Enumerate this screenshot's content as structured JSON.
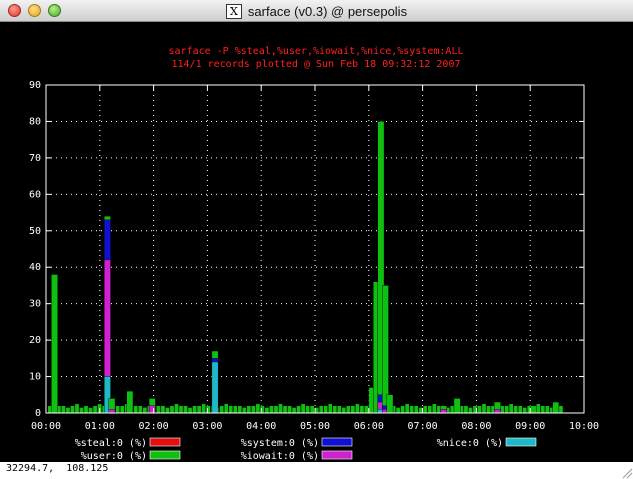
{
  "window": {
    "title": "sarface (v0.3) @ persepolis",
    "x_logo": "X"
  },
  "status_bar": {
    "coords": "32294.7,  108.125"
  },
  "colors": {
    "title": "#ff2020",
    "grid": "#ffffff",
    "steal": "#e01010",
    "user": "#10c010",
    "system": "#1010d0",
    "iowait": "#d020d0",
    "nice": "#20b8c8"
  },
  "chart_data": {
    "type": "bar",
    "title": "sarface -P %steal,%user,%iowait,%nice,%system:ALL",
    "subtitle": "114/1 records plotted @ Sun Feb 18 09:32:12 2007",
    "xlabel": "",
    "ylabel": "",
    "ylim": [
      0,
      90
    ],
    "yticks": [
      "0",
      "10",
      "20",
      "30",
      "40",
      "50",
      "60",
      "70",
      "80",
      "90"
    ],
    "xticks": [
      "00:00",
      "01:00",
      "02:00",
      "03:00",
      "04:00",
      "05:00",
      "06:00",
      "07:00",
      "08:00",
      "09:00",
      "10:00"
    ],
    "xlim_minutes": [
      0,
      600
    ],
    "grid": true,
    "series": [
      {
        "name": "%steal:0 (%)",
        "key": "steal",
        "color": "#e01010"
      },
      {
        "name": "%user:0 (%)",
        "key": "user",
        "color": "#10c010"
      },
      {
        "name": "%system:0 (%)",
        "key": "system",
        "color": "#1010d0"
      },
      {
        "name": "%iowait:0 (%)",
        "key": "iowait",
        "color": "#d020d0"
      },
      {
        "name": "%nice:0 (%)",
        "key": "nice",
        "color": "#20b8c8"
      }
    ],
    "baseline_user": [
      2,
      3,
      2,
      2,
      1.5,
      2,
      2.5,
      1.5,
      2,
      1.5,
      2,
      2.5,
      2,
      1.5,
      2,
      2,
      2,
      2.5,
      1.5,
      2,
      2,
      1.5,
      2,
      2.5,
      2,
      2,
      1.5,
      2,
      2.5,
      2,
      2,
      1.5,
      2,
      2,
      2.5,
      2,
      2,
      1.5,
      2,
      2.5,
      2,
      2,
      2,
      1.5,
      2,
      2,
      2.5,
      2,
      1.5,
      2,
      2,
      2.5,
      2,
      2,
      1.5,
      2,
      2.5,
      2,
      2,
      1.5,
      2,
      2,
      2.5,
      2,
      2,
      1.5,
      2,
      2,
      2.5,
      2,
      2,
      1.5,
      2,
      2,
      2.5,
      2,
      2,
      1.5,
      2,
      2.5,
      2,
      2,
      1.5,
      2,
      2,
      2.5,
      2,
      2,
      1.5,
      2,
      2.5,
      2,
      2,
      1.5,
      2,
      2,
      2.5,
      2,
      2,
      1.5,
      2,
      2,
      2.5,
      2,
      2,
      1.5,
      2,
      2,
      2.5,
      2,
      2,
      1.5,
      2,
      2
    ],
    "spikes": [
      {
        "time": "00:06",
        "user": 38,
        "system": 0,
        "iowait": 0,
        "nice": 0
      },
      {
        "time": "01:05",
        "user": 54,
        "system": 53,
        "iowait": 42,
        "nice": 10
      },
      {
        "time": "01:10",
        "user": 4,
        "system": 0,
        "iowait": 1,
        "nice": 0
      },
      {
        "time": "01:30",
        "user": 6,
        "system": 0,
        "iowait": 0,
        "nice": 0
      },
      {
        "time": "01:55",
        "user": 4,
        "system": 0,
        "iowait": 2,
        "nice": 0
      },
      {
        "time": "03:05",
        "user": 17,
        "system": 15,
        "iowait": 0,
        "nice": 14
      },
      {
        "time": "06:00",
        "user": 7,
        "system": 0,
        "iowait": 0,
        "nice": 0
      },
      {
        "time": "06:05",
        "user": 36,
        "system": 0,
        "iowait": 0,
        "nice": 0
      },
      {
        "time": "06:10",
        "user": 80,
        "system": 5,
        "iowait": 3,
        "nice": 1
      },
      {
        "time": "06:15",
        "user": 35,
        "system": 2,
        "iowait": 1,
        "nice": 0
      },
      {
        "time": "06:20",
        "user": 5,
        "system": 0,
        "iowait": 0,
        "nice": 0
      },
      {
        "time": "07:20",
        "user": 2,
        "system": 0,
        "iowait": 1,
        "nice": 0
      },
      {
        "time": "07:35",
        "user": 4,
        "system": 0,
        "iowait": 0,
        "nice": 0
      },
      {
        "time": "08:20",
        "user": 3,
        "system": 0,
        "iowait": 1,
        "nice": 0
      },
      {
        "time": "09:00",
        "user": 2,
        "system": 0,
        "iowait": 0,
        "nice": 0
      },
      {
        "time": "09:25",
        "user": 3,
        "system": 0,
        "iowait": 0,
        "nice": 0
      }
    ]
  }
}
